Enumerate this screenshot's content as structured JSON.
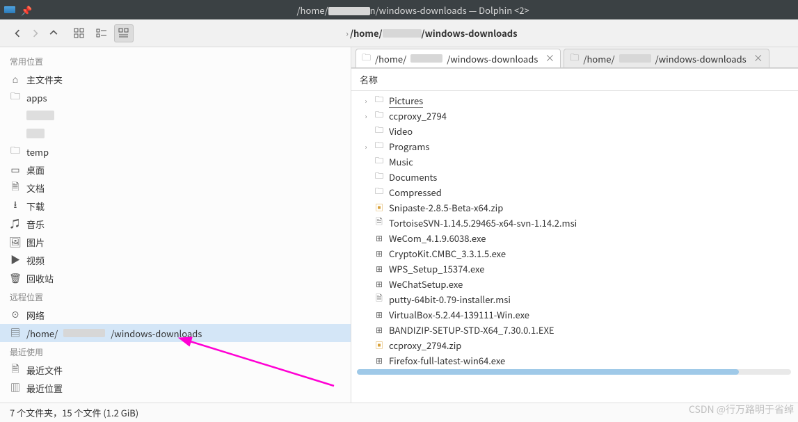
{
  "window": {
    "title_prefix": "/home/",
    "title_suffix": "n/windows-downloads — Dolphin <2>"
  },
  "breadcrumb": {
    "seg1": "/home/",
    "seg2": "/windows-downloads"
  },
  "sidebar": {
    "groups": {
      "places": "常用位置",
      "remote": "远程位置",
      "recent": "最近使用"
    },
    "home": "主文件夹",
    "apps": "apps",
    "temp": "temp",
    "desktop": "桌面",
    "documents": "文档",
    "downloads": "下载",
    "music": "音乐",
    "pictures": "图片",
    "videos": "视频",
    "trash": "回收站",
    "network": "网络",
    "remote_path_pre": "/home/",
    "remote_path_post": "/windows-downloads",
    "recent_files": "最近文件",
    "recent_locations": "最近位置"
  },
  "tabs": {
    "t1_pre": "/home/",
    "t1_post": "/windows-downloads",
    "t2_pre": "/home/",
    "t2_post": "/windows-downloads"
  },
  "header": {
    "name": "名称"
  },
  "files": [
    {
      "name": "Pictures",
      "kind": "folder",
      "expandable": true,
      "underline": true
    },
    {
      "name": "ccproxy_2794",
      "kind": "folder",
      "expandable": true
    },
    {
      "name": "Video",
      "kind": "folder"
    },
    {
      "name": "Programs",
      "kind": "folder",
      "expandable": true
    },
    {
      "name": "Music",
      "kind": "folder"
    },
    {
      "name": "Documents",
      "kind": "folder"
    },
    {
      "name": "Compressed",
      "kind": "folder"
    },
    {
      "name": "Snipaste-2.8.5-Beta-x64.zip",
      "kind": "zip"
    },
    {
      "name": "TortoiseSVN-1.14.5.29465-x64-svn-1.14.2.msi",
      "kind": "file"
    },
    {
      "name": "WeCom_4.1.9.6038.exe",
      "kind": "exe"
    },
    {
      "name": "CryptoKit.CMBC_3.3.1.5.exe",
      "kind": "exe"
    },
    {
      "name": "WPS_Setup_15374.exe",
      "kind": "exe"
    },
    {
      "name": "WeChatSetup.exe",
      "kind": "exe"
    },
    {
      "name": "putty-64bit-0.79-installer.msi",
      "kind": "file"
    },
    {
      "name": "VirtualBox-5.2.44-139111-Win.exe",
      "kind": "exe"
    },
    {
      "name": "BANDIZIP-SETUP-STD-X64_7.30.0.1.EXE",
      "kind": "exe"
    },
    {
      "name": "ccproxy_2794.zip",
      "kind": "zip"
    },
    {
      "name": "Firefox-full-latest-win64.exe",
      "kind": "exe"
    }
  ],
  "status": {
    "text": "7 个文件夹，15 个文件 (1.2 GiB)"
  },
  "watermark": "CSDN @行万路明于省绰"
}
